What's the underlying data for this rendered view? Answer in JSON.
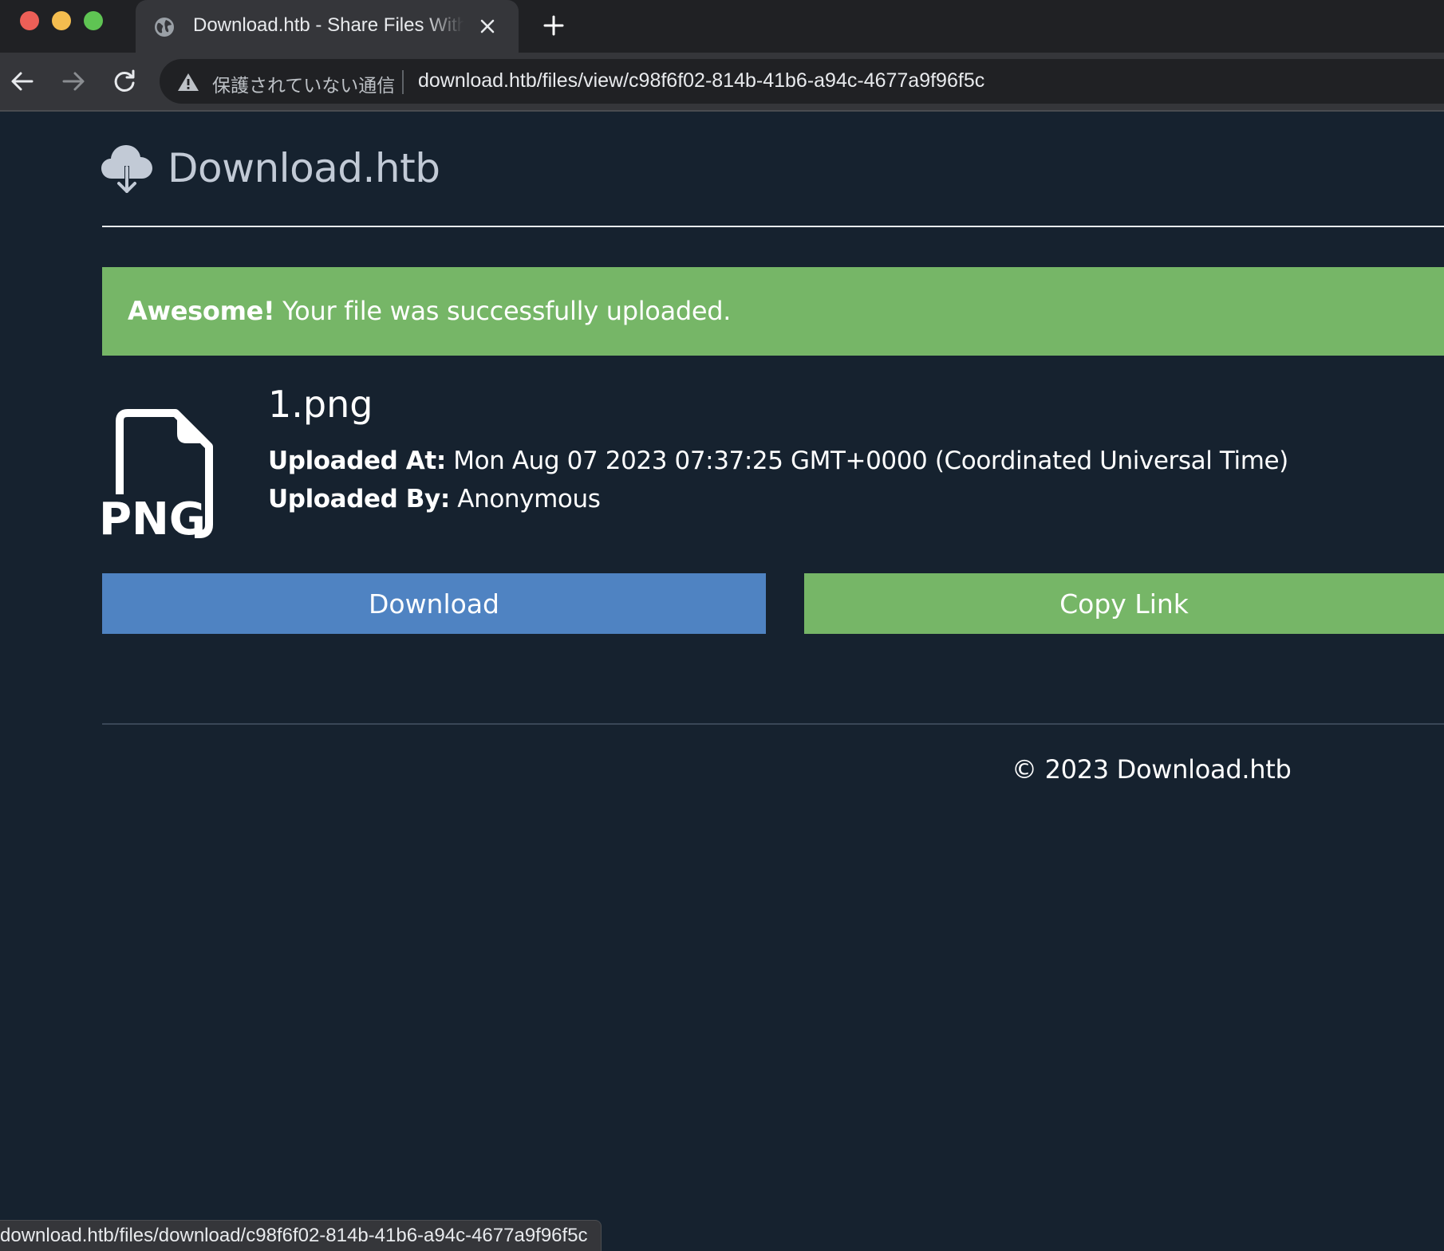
{
  "browser": {
    "tab_title": "Download.htb - Share Files With Ease",
    "security_label": "保護されていない通信",
    "url": "download.htb/files/view/c98f6f02-814b-41b6-a94c-4677a9f96f5c",
    "status_url": "download.htb/files/download/c98f6f02-814b-41b6-a94c-4677a9f96f5c",
    "icons": [
      "globe-icon",
      "close-icon",
      "plus-icon",
      "back-arrow-icon",
      "forward-arrow-icon",
      "reload-icon",
      "warning-icon"
    ]
  },
  "site": {
    "brand": "Download.htb",
    "logo_icon": "cloud-download-icon"
  },
  "alert": {
    "strong": "Awesome!",
    "message": " Your file was successfully uploaded.",
    "color": "#76b667"
  },
  "file": {
    "type_label": "PNG",
    "icon": "png-file-icon",
    "name": "1.png",
    "uploaded_at_label": "Uploaded At:",
    "uploaded_at_value": " Mon Aug 07 2023 07:37:25 GMT+0000 (Coordinated Universal Time)",
    "uploaded_by_label": "Uploaded By:",
    "uploaded_by_value": " Anonymous"
  },
  "actions": {
    "download_label": "Download",
    "copy_label": "Copy Link",
    "download_color": "#4f83c2",
    "copy_color": "#76b667"
  },
  "footer": {
    "copyright": "© 2023 Download.htb"
  },
  "theme": {
    "background": "#16222f"
  }
}
